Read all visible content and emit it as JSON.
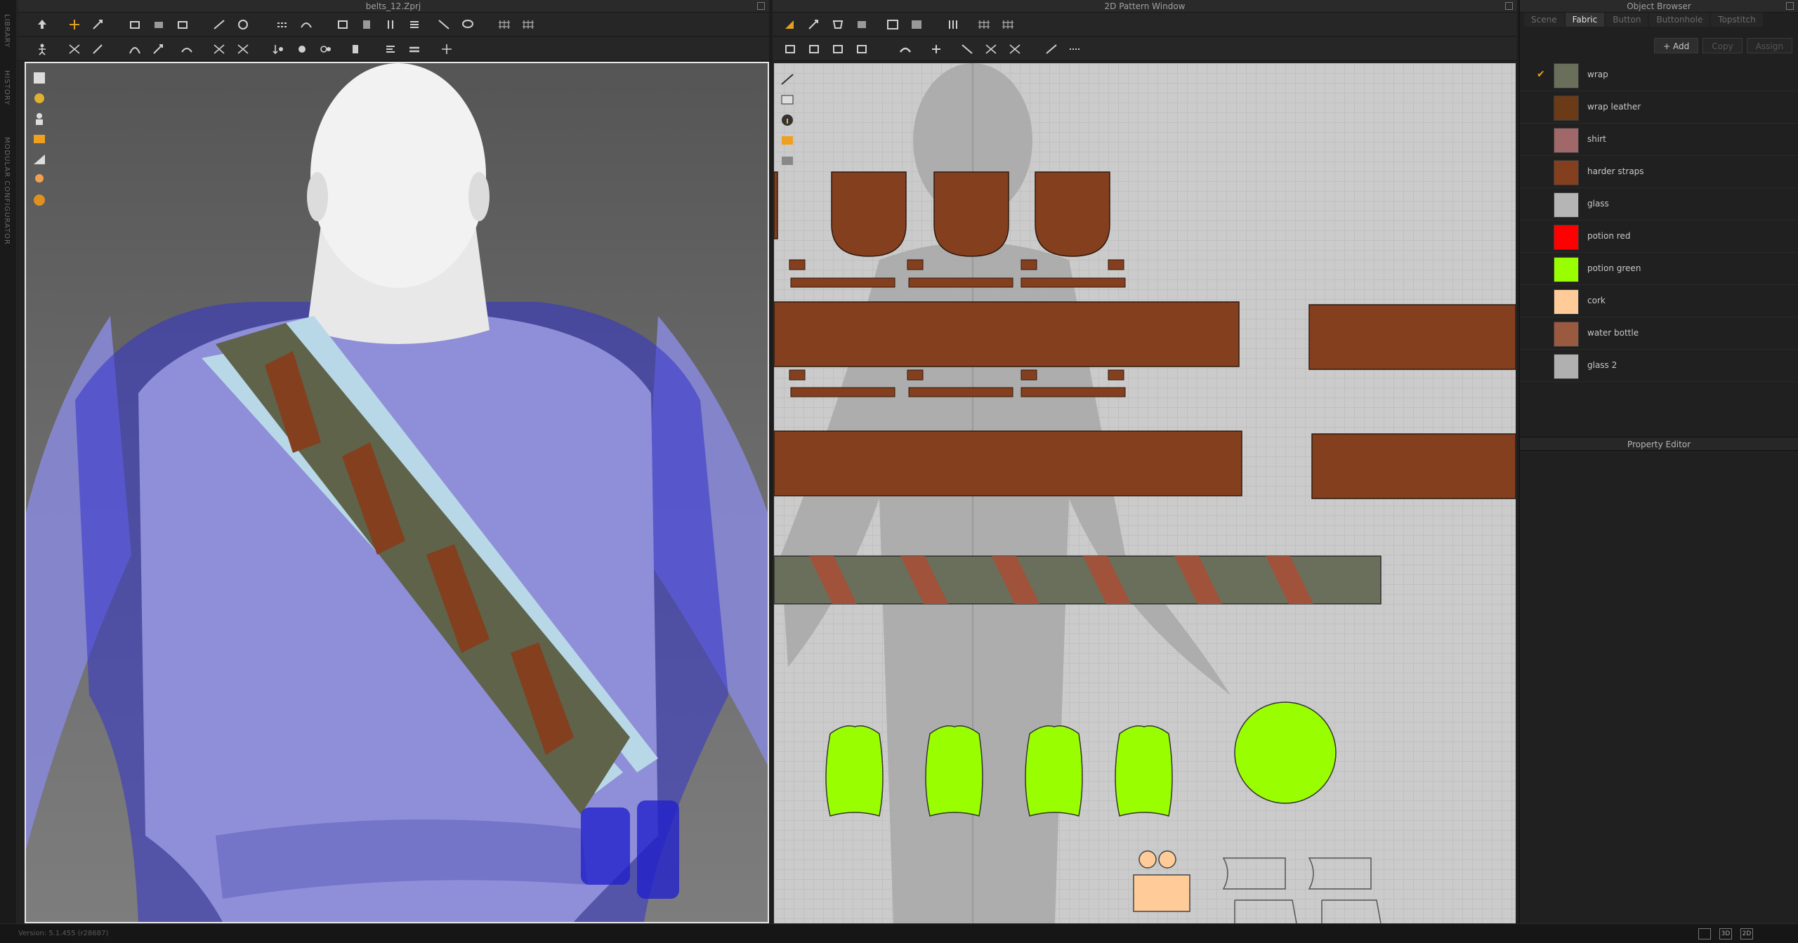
{
  "side_tabs": [
    "LIBRARY",
    "HISTORY",
    "MODULAR CONFIGURATOR"
  ],
  "viewport3d": {
    "title": "belts_12.Zprj"
  },
  "pattern2d": {
    "title": "2D Pattern Window"
  },
  "object_browser": {
    "title": "Object Browser",
    "tabs": [
      "Scene",
      "Fabric",
      "Button",
      "Buttonhole",
      "Topstitch"
    ],
    "active_tab": "Fabric",
    "buttons": {
      "add": "+ Add",
      "copy": "Copy",
      "assign": "Assign"
    },
    "fabrics": [
      {
        "name": "wrap",
        "color": "#6a6f5c",
        "checked": true
      },
      {
        "name": "wrap leather",
        "color": "#6b3a17",
        "checked": false
      },
      {
        "name": "shirt",
        "color": "#a06868",
        "checked": false
      },
      {
        "name": "harder straps",
        "color": "#843f1e",
        "checked": false
      },
      {
        "name": "glass",
        "color": "#b5b5b5",
        "checked": false
      },
      {
        "name": "potion red",
        "color": "#ff0000",
        "checked": false
      },
      {
        "name": "potion green",
        "color": "#99ff00",
        "checked": false
      },
      {
        "name": "cork",
        "color": "#ffcc99",
        "checked": false
      },
      {
        "name": "water bottle",
        "color": "#9a5a40",
        "checked": false
      },
      {
        "name": "glass 2",
        "color": "#b0b0b0",
        "checked": false
      }
    ]
  },
  "property_editor": {
    "title": "Property Editor"
  },
  "status": {
    "version": "Version: 5.1.455 (r28687)",
    "view_buttons": [
      "",
      "3D",
      "2D"
    ]
  },
  "colors": {
    "leather": "#843f1e",
    "wrap": "#6a6f5c",
    "potion_green": "#99ff00",
    "cork": "#ffcc99",
    "shirt_blue": "#7b7ad0"
  }
}
